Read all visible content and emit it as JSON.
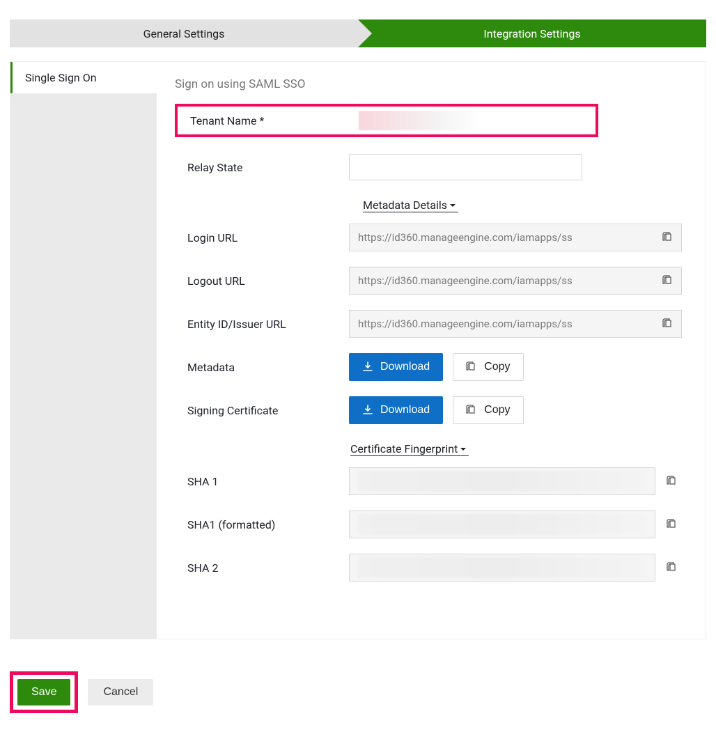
{
  "stepper": {
    "step1": "General Settings",
    "step2": "Integration Settings"
  },
  "sidebar": {
    "item1": "Single Sign On"
  },
  "section": {
    "title": "Sign on using SAML SSO"
  },
  "fields": {
    "tenantName": {
      "label": "Tenant Name",
      "required": "*"
    },
    "relayState": {
      "label": "Relay State",
      "value": ""
    },
    "metadataDetails": "Metadata Details",
    "loginUrl": {
      "label": "Login URL",
      "value": "https://id360.manageengine.com/iamapps/ss"
    },
    "logoutUrl": {
      "label": "Logout URL",
      "value": "https://id360.manageengine.com/iamapps/ss"
    },
    "entityId": {
      "label": "Entity ID/Issuer URL",
      "value": "https://id360.manageengine.com/iamapps/ss"
    },
    "metadata": {
      "label": "Metadata"
    },
    "signingCert": {
      "label": "Signing Certificate"
    },
    "certFingerprint": "Certificate Fingerprint",
    "sha1": {
      "label": "SHA 1"
    },
    "sha1fmt": {
      "label": "SHA1 (formatted)"
    },
    "sha2": {
      "label": "SHA 2"
    }
  },
  "buttons": {
    "download": "Download",
    "copy": "Copy",
    "save": "Save",
    "cancel": "Cancel"
  }
}
